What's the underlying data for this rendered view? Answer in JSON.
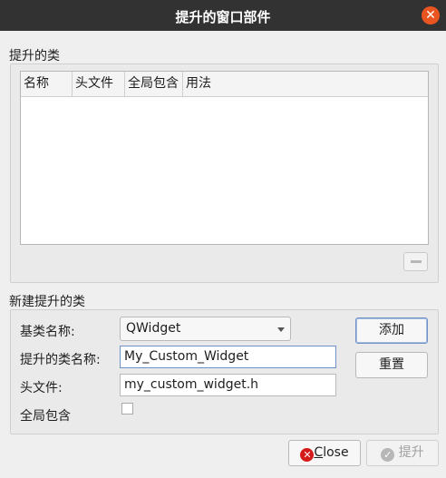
{
  "window": {
    "title": "提升的窗口部件",
    "close_glyph": "✕"
  },
  "promoted_section": {
    "label": "提升的类",
    "columns": [
      "名称",
      "头文件",
      "全局包含",
      "用法"
    ],
    "rows": [],
    "remove_glyph": "—"
  },
  "new_section": {
    "label": "新建提升的类",
    "base_class": {
      "label": "基类名称:",
      "value": "QWidget"
    },
    "class_name": {
      "label": "提升的类名称:",
      "value": "My_Custom_Widget"
    },
    "header_file": {
      "label": "头文件:",
      "value": "my_custom_widget.h"
    },
    "global_include": {
      "label": "全局包含",
      "checked": false
    },
    "add_button": "添加",
    "reset_button": "重置"
  },
  "footer": {
    "close": {
      "mnemonic": "C",
      "rest": "lose",
      "icon_glyph": "✕"
    },
    "promote": {
      "label": "提升",
      "icon_glyph": "✓"
    }
  },
  "colors": {
    "titlebar": "#333232",
    "accent": "#e95420",
    "close_icon": "#d51a1a",
    "focus": "#6d91c7"
  }
}
